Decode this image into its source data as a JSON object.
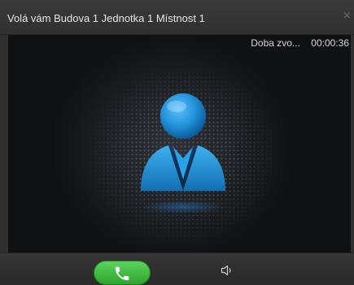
{
  "window": {
    "title": "Volá vám Budova 1 Jednotka 1 Místnost 1",
    "close_glyph": "×"
  },
  "call": {
    "duration_label": "Doba zvo...",
    "duration_value": "00:00:36"
  },
  "avatar": {
    "icon": "person-icon",
    "color": "#1f8fd6"
  },
  "toolbar": {
    "answer_icon": "phone-icon",
    "answer_color": "#3cb83c",
    "speaker_icon": "speaker-icon"
  }
}
